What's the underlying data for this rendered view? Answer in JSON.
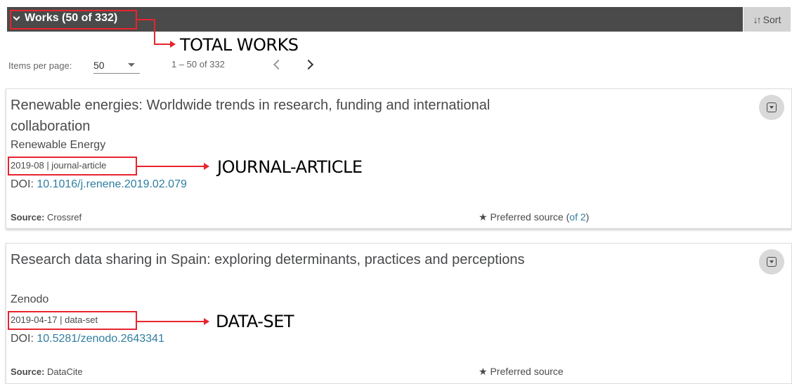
{
  "header": {
    "toggle_label": "Works (50 of 332)",
    "sort_label": "Sort",
    "sort_icon": "sort-arrows-icon",
    "toggle_icon": "chevron-down-icon"
  },
  "annotations": {
    "total_works": "TOTAL WORKS",
    "journal_article": "JOURNAL-ARTICLE",
    "data_set": "DATA-SET",
    "color": "#e8242e"
  },
  "pagination": {
    "items_per_page_label": "Items per page:",
    "items_per_page_value": "50",
    "range_label": "1 – 50 of 332"
  },
  "works": [
    {
      "title": "Renewable energies: Worldwide trends in research, funding and international collaboration",
      "journal": "Renewable Energy",
      "meta": "2019-08 | journal-article",
      "doi_label": "DOI: ",
      "doi": "10.1016/j.renene.2019.02.079",
      "source_label": "Source:",
      "source": "Crossref",
      "preferred_label": "Preferred source",
      "preferred_open": "(",
      "preferred_link": "of 2",
      "preferred_close": ")"
    },
    {
      "title": "Research data sharing in Spain: exploring determinants, practices and perceptions",
      "journal": "Zenodo",
      "meta": "2019-04-17 | data-set",
      "doi_label": "DOI: ",
      "doi": "10.5281/zenodo.2643341",
      "source_label": "Source:",
      "source": "DataCite",
      "preferred_label": "Preferred source"
    }
  ],
  "colors": {
    "header_bg": "#4a4a4a",
    "sort_bg": "#d3d3d3",
    "link": "#2e7f9f",
    "text": "#494a4c"
  }
}
